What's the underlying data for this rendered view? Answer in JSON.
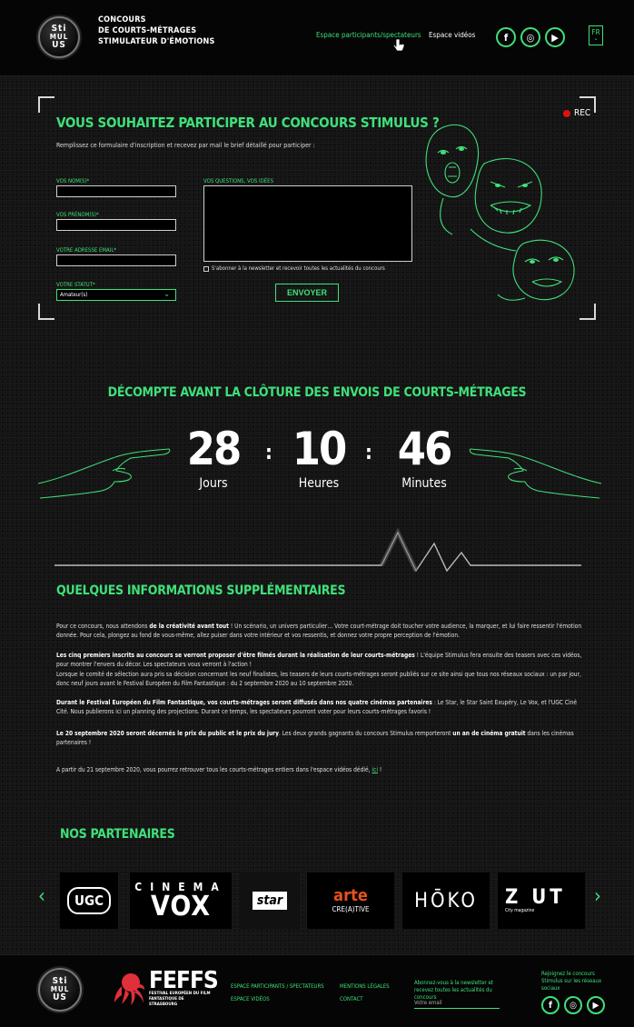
{
  "header": {
    "logo": {
      "line1": "Sti",
      "line2": "MUL",
      "line3": "US"
    },
    "title_lines": [
      "CONCOURS",
      "DE COURTS-MÉTRAGES",
      "STIMULATEUR D'ÉMOTIONS"
    ],
    "nav": {
      "participants": "Espace participants/spectateurs",
      "videos": "Espace vidéos"
    },
    "social": {
      "facebook": "f",
      "instagram": "◎",
      "youtube": "▶"
    },
    "lang": "FR",
    "lang_caret": "⌄"
  },
  "form": {
    "rec": "REC",
    "title": "VOUS SOUHAITEZ PARTICIPER AU CONCOURS STIMULUS ?",
    "intro": "Remplissez ce formulaire d'inscription et recevez par mail le brief détaillé pour participer :",
    "labels": {
      "name": "VOS NOM(S)*",
      "firstname": "VOS PRÉNOM(S)*",
      "email": "VOTRE ADRESSE EMAIL*",
      "status": "VOTRE STATUT*",
      "questions": "VOS QUESTIONS, VOS IDÉES"
    },
    "values": {
      "name": "",
      "firstname": "",
      "email": "",
      "questions": ""
    },
    "status_value": "Amateur(s)",
    "newsletter": "S'abonner à la newsletter et recevoir toutes les actualités du concours",
    "submit": "ENVOYER"
  },
  "countdown": {
    "title": "DÉCOMPTE AVANT LA CLÔTURE DES ENVOIS DE COURTS-MÉTRAGES",
    "days": "28",
    "days_label": "Jours",
    "hours": "10",
    "hours_label": "Heures",
    "minutes": "46",
    "minutes_label": "Minutes",
    "separator": ":"
  },
  "info": {
    "title": "QUELQUES INFORMATIONS SUPPLÉMENTAIRES",
    "p1_a": "Pour ce concours, nous attendons ",
    "p1_b": "de la créativité avant tout",
    "p1_c": " ! Un scénario, un univers particulier… Votre court-métrage doit toucher votre audience, la marquer, et lui faire ressentir l'émotion donnée. Pour cela, plongez au fond de vous-même, allez puiser dans votre intérieur et vos ressentis, et donnez votre propre perception de l'émotion.",
    "p2_a": "Les cinq premiers inscrits au concours se verront proposer d'être filmés durant la réalisation de leur courts-métrages",
    "p2_b": " ! L'équipe Stimulus fera ensuite des teasers avec ces vidéos, pour montrer l'envers du décor. Les spectateurs vous verront à l'action !",
    "p2_c": "Lorsque le comité de sélection aura pris sa décision concernant les neuf finalistes, les teasers de leurs courts-métrages seront publiés sur ce site ainsi que tous nos réseaux sociaux : un par jour, donc neuf jours avant le Festival Européen du Film Fantastique : du 2 septembre 2020 au 10 septembre 2020.",
    "p3_a": "Durant le Festival Européen du Film Fantastique, vos courts-métrages seront diffusés dans nos quatre cinémas partenaires",
    "p3_b": " : Le Star, le Star Saint Exupéry, Le Vox, et l'UGC Ciné Cité. Nous publierons ici un planning des projections. Durant ce temps, les spectateurs pourront voter pour leurs courts-métrages favoris !",
    "p4_a": "Le 20 septembre 2020 seront décernés le prix du public et le prix du jury",
    "p4_b": ". Les deux grands gagnants du concours Stimulus remporteront ",
    "p4_c": "un an de cinéma gratuit",
    "p4_d": " dans les cinémas partenaires !",
    "p5_a": "A partir du 21 septembre 2020, vous pourrez retrouver tous les courts-métrages entiers dans l'espace vidéos dédié, ",
    "p5_link": "ici",
    "p5_b": " !"
  },
  "partners": {
    "title": "NOS PARTENAIRES",
    "prev": "‹",
    "next": "›",
    "ugc": "UGC",
    "vox_top": "CINEMA",
    "vox": "VOX",
    "star": "star",
    "arte": "arte",
    "arte_sub": "CRE(A)TIVE",
    "hoko": "HŌKO",
    "zut": "Z UT",
    "zut_sub": "City magazine"
  },
  "footer": {
    "feffs": "FEFFS",
    "feffs_sub": "FESTIVAL EUROPÉEN DU FILM FANTASTIQUE DE STRASBOURG",
    "link_participants": "ESPACE PARTICIPANTS / SPECTATEURS",
    "link_videos": "ESPACE VIDÉOS",
    "link_legal": "MENTIONS LÉGALES",
    "link_contact": "CONTACT",
    "newsletter_note": "Abonnez-vous à la newsletter et recevez toutes les actualités du concours",
    "email_placeholder": "Votre email",
    "social_note": "Rejoignez le concours Stimulus sur les réseaux sociaux"
  }
}
